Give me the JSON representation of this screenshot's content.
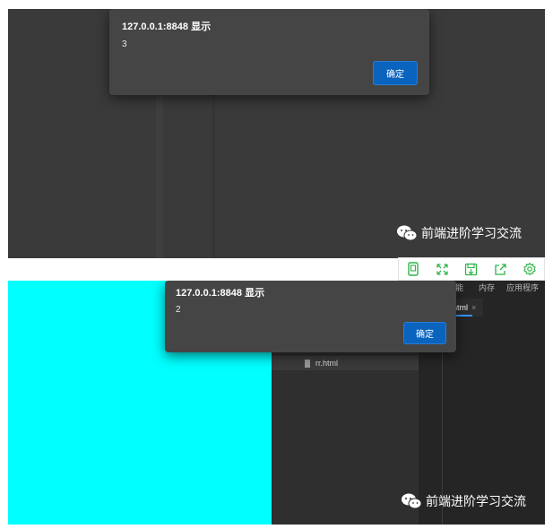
{
  "top_panel": {
    "dialog": {
      "title": "127.0.0.1:8848 显示",
      "message": "3",
      "ok_label": "确定"
    },
    "watermark": "前端进阶学习交流"
  },
  "toolbar": {
    "icons": [
      "phone-icon",
      "expand-icon",
      "save-icon",
      "share-icon",
      "settings-icon"
    ],
    "color": "#2fb34a"
  },
  "bottom_panel": {
    "dialog": {
      "title": "127.0.0.1:8848 显示",
      "message": "2",
      "ok_label": "确定"
    },
    "background_color": "#00ffff",
    "editor_menu": [
      "能",
      "内存",
      "应用程序"
    ],
    "editor_tab": "html",
    "editor_tab_close": "×",
    "explorer_file": "rr.html",
    "watermark": "前端进阶学习交流"
  }
}
